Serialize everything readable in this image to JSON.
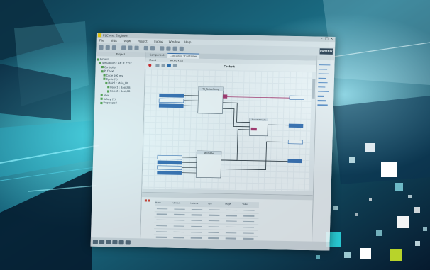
{
  "app": {
    "title": "PLCnext Engineer",
    "logo_icon": "plcnext-logo-icon",
    "brand": "PHOENIX"
  },
  "menu": [
    "File",
    "Edit",
    "View",
    "Project",
    "Extras",
    "Window",
    "Help"
  ],
  "left_panel": {
    "header": "Project",
    "tree": [
      "Project",
      "Simulation : AXC F 2152",
      "Controller",
      "PLCnext",
      "Cycle 100 ms",
      "Cyclic (1)",
      "Main1 : Main_FB",
      "Basic1 : BasicFB",
      "Basic2 : BasicFB",
      "Main",
      "Safety (1)",
      "Ungrouped"
    ]
  },
  "editor": {
    "tabs": [
      "Components",
      "Container : Container",
      "Main1",
      "Network (1)"
    ],
    "canvas_title": "Cockpit",
    "blocks": [
      "TC_ToHexString",
      "TransferModule",
      "WriteFile"
    ]
  },
  "bottom_panel": {
    "columns": [
      "Name",
      "Variable",
      "Instance",
      "Type",
      "Usage",
      "Value"
    ]
  },
  "colors": {
    "accent": "#2f6fb3",
    "record": "#e02020",
    "connection": "#b0306a",
    "background_glow": "#39e6e3",
    "lime": "#b8d32a"
  }
}
